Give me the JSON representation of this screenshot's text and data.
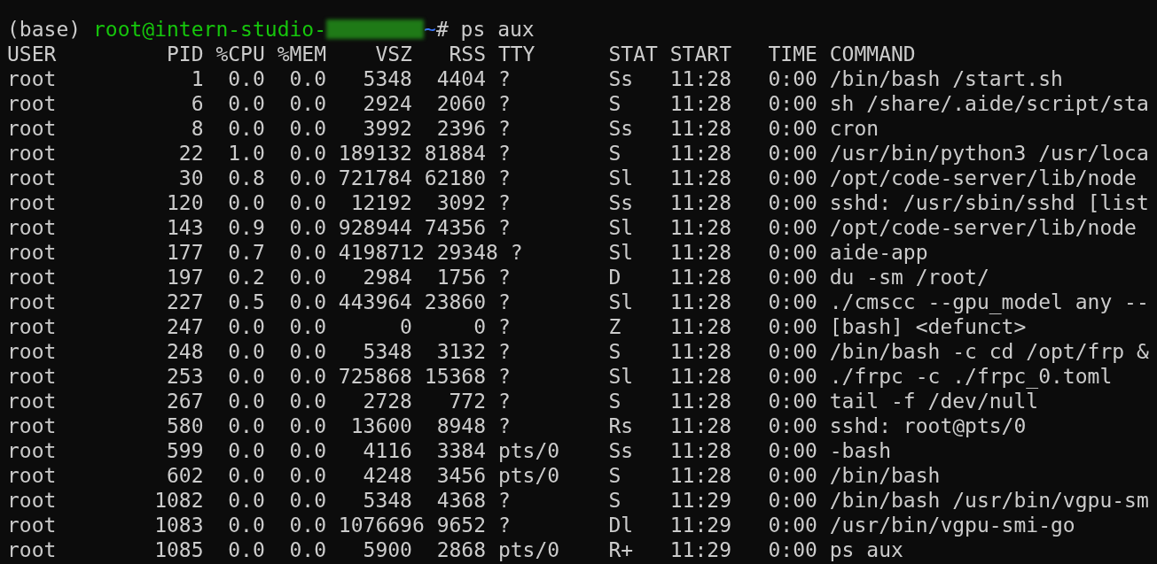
{
  "prompt": {
    "env": "(base)",
    "user_host": "root@intern-studio-",
    "cwd": "~",
    "symbol": "#",
    "command": "ps aux"
  },
  "table": {
    "columns": [
      "USER",
      "PID",
      "%CPU",
      "%MEM",
      "VSZ",
      "RSS",
      "TTY",
      "STAT",
      "START",
      "TIME",
      "COMMAND"
    ],
    "rows": [
      [
        "root",
        "1",
        "0.0",
        "0.0",
        "5348",
        "4404",
        "?",
        "Ss",
        "11:28",
        "0:00",
        "/bin/bash /start.sh"
      ],
      [
        "root",
        "6",
        "0.0",
        "0.0",
        "2924",
        "2060",
        "?",
        "S",
        "11:28",
        "0:00",
        "sh /share/.aide/script/sta"
      ],
      [
        "root",
        "8",
        "0.0",
        "0.0",
        "3992",
        "2396",
        "?",
        "Ss",
        "11:28",
        "0:00",
        "cron"
      ],
      [
        "root",
        "22",
        "1.0",
        "0.0",
        "189132",
        "81884",
        "?",
        "S",
        "11:28",
        "0:00",
        "/usr/bin/python3 /usr/loca"
      ],
      [
        "root",
        "30",
        "0.8",
        "0.0",
        "721784",
        "62180",
        "?",
        "Sl",
        "11:28",
        "0:00",
        "/opt/code-server/lib/node"
      ],
      [
        "root",
        "120",
        "0.0",
        "0.0",
        "12192",
        "3092",
        "?",
        "Ss",
        "11:28",
        "0:00",
        "sshd: /usr/sbin/sshd [list"
      ],
      [
        "root",
        "143",
        "0.9",
        "0.0",
        "928944",
        "74356",
        "?",
        "Sl",
        "11:28",
        "0:00",
        "/opt/code-server/lib/node"
      ],
      [
        "root",
        "177",
        "0.7",
        "0.0",
        "4198712",
        "29348",
        "?",
        "Sl",
        "11:28",
        "0:00",
        "aide-app"
      ],
      [
        "root",
        "197",
        "0.2",
        "0.0",
        "2984",
        "1756",
        "?",
        "D",
        "11:28",
        "0:00",
        "du -sm /root/"
      ],
      [
        "root",
        "227",
        "0.5",
        "0.0",
        "443964",
        "23860",
        "?",
        "Sl",
        "11:28",
        "0:00",
        "./cmscc --gpu_model any --"
      ],
      [
        "root",
        "247",
        "0.0",
        "0.0",
        "0",
        "0",
        "?",
        "Z",
        "11:28",
        "0:00",
        "[bash] <defunct>"
      ],
      [
        "root",
        "248",
        "0.0",
        "0.0",
        "5348",
        "3132",
        "?",
        "S",
        "11:28",
        "0:00",
        "/bin/bash -c cd /opt/frp &"
      ],
      [
        "root",
        "253",
        "0.0",
        "0.0",
        "725868",
        "15368",
        "?",
        "Sl",
        "11:28",
        "0:00",
        "./frpc -c ./frpc_0.toml"
      ],
      [
        "root",
        "267",
        "0.0",
        "0.0",
        "2728",
        "772",
        "?",
        "S",
        "11:28",
        "0:00",
        "tail -f /dev/null"
      ],
      [
        "root",
        "580",
        "0.0",
        "0.0",
        "13600",
        "8948",
        "?",
        "Rs",
        "11:28",
        "0:00",
        "sshd: root@pts/0"
      ],
      [
        "root",
        "599",
        "0.0",
        "0.0",
        "4116",
        "3384",
        "pts/0",
        "Ss",
        "11:28",
        "0:00",
        "-bash"
      ],
      [
        "root",
        "602",
        "0.0",
        "0.0",
        "4248",
        "3456",
        "pts/0",
        "S",
        "11:28",
        "0:00",
        "/bin/bash"
      ],
      [
        "root",
        "1082",
        "0.0",
        "0.0",
        "5348",
        "4368",
        "?",
        "S",
        "11:29",
        "0:00",
        "/bin/bash /usr/bin/vgpu-sm"
      ],
      [
        "root",
        "1083",
        "0.0",
        "0.0",
        "1076696",
        "9652",
        "?",
        "Dl",
        "11:29",
        "0:00",
        "/usr/bin/vgpu-smi-go"
      ],
      [
        "root",
        "1085",
        "0.0",
        "0.0",
        "5900",
        "2868",
        "pts/0",
        "R+",
        "11:29",
        "0:00",
        "ps aux"
      ]
    ]
  }
}
